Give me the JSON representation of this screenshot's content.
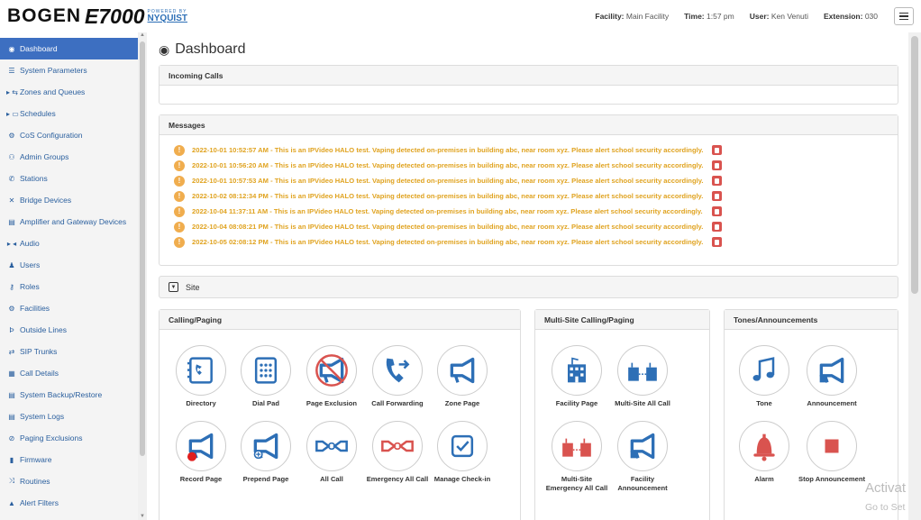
{
  "header": {
    "brand": "BOGEN",
    "product": "E7000",
    "powered_by": "POWERED BY",
    "partner": "NYQUIST",
    "facility_label": "Facility:",
    "facility_value": "Main Facility",
    "time_label": "Time:",
    "time_value": "1:57 pm",
    "user_label": "User:",
    "user_value": "Ken Venuti",
    "extension_label": "Extension:",
    "extension_value": "030",
    "menu_icon": "hamburger-icon"
  },
  "sidebar": {
    "items": [
      {
        "label": "Dashboard",
        "icon": "dashboard-icon",
        "glyph": "◉",
        "active": true
      },
      {
        "label": "System Parameters",
        "icon": "list-icon",
        "glyph": "☰"
      },
      {
        "label": "Zones and Queues",
        "icon": "zones-icon",
        "glyph": "▸ ⇆"
      },
      {
        "label": "Schedules",
        "icon": "calendar-icon",
        "glyph": "▸ ▭"
      },
      {
        "label": "CoS Configuration",
        "icon": "cogs-icon",
        "glyph": "⚙"
      },
      {
        "label": "Admin Groups",
        "icon": "users-icon",
        "glyph": "⚇"
      },
      {
        "label": "Stations",
        "icon": "phone-icon",
        "glyph": "✆"
      },
      {
        "label": "Bridge Devices",
        "icon": "bridge-icon",
        "glyph": "✕"
      },
      {
        "label": "Amplifier and Gateway Devices",
        "icon": "amplifier-icon",
        "glyph": "▤"
      },
      {
        "label": "Audio",
        "icon": "audio-icon",
        "glyph": "▸ ◂"
      },
      {
        "label": "Users",
        "icon": "user-icon",
        "glyph": "♟"
      },
      {
        "label": "Roles",
        "icon": "key-icon",
        "glyph": "⚷"
      },
      {
        "label": "Facilities",
        "icon": "facilities-icon",
        "glyph": "⚙"
      },
      {
        "label": "Outside Lines",
        "icon": "pbx-icon",
        "glyph": "Þ"
      },
      {
        "label": "SIP Trunks",
        "icon": "exchange-icon",
        "glyph": "⇄"
      },
      {
        "label": "Call Details",
        "icon": "table-icon",
        "glyph": "▦"
      },
      {
        "label": "System Backup/Restore",
        "icon": "backup-icon",
        "glyph": "▤"
      },
      {
        "label": "System Logs",
        "icon": "file-icon",
        "glyph": "▤"
      },
      {
        "label": "Paging Exclusions",
        "icon": "ban-icon",
        "glyph": "⊘"
      },
      {
        "label": "Firmware",
        "icon": "firmware-icon",
        "glyph": "▮"
      },
      {
        "label": "Routines",
        "icon": "random-icon",
        "glyph": "⤨"
      },
      {
        "label": "Alert Filters",
        "icon": "alert-icon",
        "glyph": "▲"
      }
    ]
  },
  "main": {
    "title": "Dashboard",
    "incoming_calls": {
      "title": "Incoming Calls"
    },
    "messages": {
      "title": "Messages",
      "items": [
        "2022-10-01 10:52:57 AM - This is an IPVideo HALO test. Vaping detected on-premises in building abc, near room xyz. Please alert school security accordingly.",
        "2022-10-01 10:56:20 AM - This is an IPVideo HALO test. Vaping detected on-premises in building abc, near room xyz. Please alert school security accordingly.",
        "2022-10-01 10:57:53 AM - This is an IPVideo HALO test. Vaping detected on-premises in building abc, near room xyz. Please alert school security accordingly.",
        "2022-10-02 08:12:34 PM - This is an IPVideo HALO test. Vaping detected on-premises in building abc, near room xyz. Please alert school security accordingly.",
        "2022-10-04 11:37:11 AM - This is an IPVideo HALO test. Vaping detected on-premises in building abc, near room xyz. Please alert school security accordingly.",
        "2022-10-04 08:08:21 PM - This is an IPVideo HALO test. Vaping detected on-premises in building abc, near room xyz. Please alert school security accordingly.",
        "2022-10-05 02:08:12 PM - This is an IPVideo HALO test. Vaping detected on-premises in building abc, near room xyz. Please alert school security accordingly."
      ]
    },
    "site": {
      "label": "Site"
    },
    "calling_paging": {
      "title": "Calling/Paging",
      "tiles": [
        "Directory",
        "Dial Pad",
        "Page Exclusion",
        "Call Forwarding",
        "Zone Page",
        "Record Page",
        "Prepend Page",
        "All Call",
        "Emergency All Call",
        "Manage Check-in"
      ]
    },
    "multi_site": {
      "title": "Multi-Site Calling/Paging",
      "tiles": [
        "Facility Page",
        "Multi-Site All Call",
        "Multi-Site Emergency All Call",
        "Facility Announcement"
      ]
    },
    "tones": {
      "title": "Tones/Announcements",
      "tiles": [
        "Tone",
        "Announcement",
        "Alarm",
        "Stop Announcement"
      ]
    }
  },
  "watermark": {
    "line1": "Activat",
    "line2": "Go to Set"
  },
  "colors": {
    "blue": "#2d6fb6",
    "red": "#d9534f",
    "warning": "#f0ad4e",
    "sidebar_active": "#3d6fc1"
  }
}
